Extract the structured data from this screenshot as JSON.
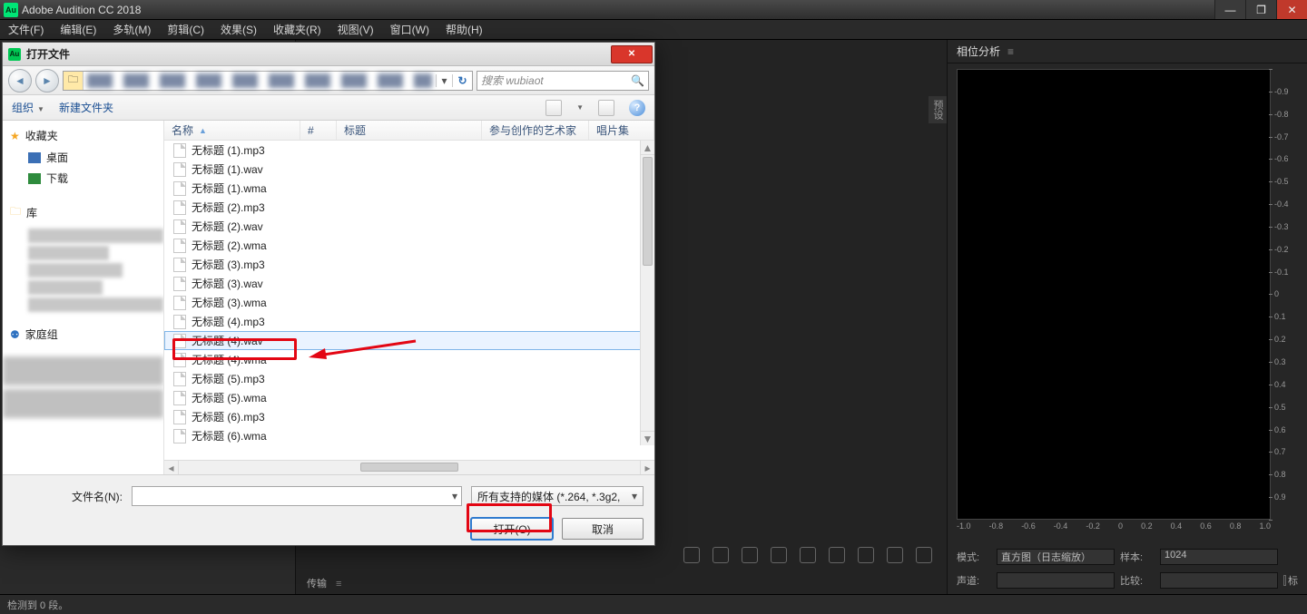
{
  "app": {
    "name": "Adobe Audition CC 2018",
    "icon_text": "Au"
  },
  "menus": [
    {
      "label": "文件(F)"
    },
    {
      "label": "编辑(E)"
    },
    {
      "label": "多轨(M)"
    },
    {
      "label": "剪辑(C)"
    },
    {
      "label": "效果(S)"
    },
    {
      "label": "收藏夹(R)"
    },
    {
      "label": "视图(V)"
    },
    {
      "label": "窗口(W)"
    },
    {
      "label": "帮助(H)"
    }
  ],
  "right_panel": {
    "title": "相位分析",
    "y_ticks": [
      "",
      "-0.9",
      "-0.8",
      "-0.7",
      "-0.6",
      "-0.5",
      "-0.4",
      "-0.3",
      "-0.2",
      "-0.1",
      "0",
      "0.1",
      "0.2",
      "0.3",
      "0.4",
      "0.5",
      "0.6",
      "0.7",
      "0.8",
      "0.9",
      ""
    ],
    "x_ticks": [
      "-1.0",
      "-0.8",
      "-0.6",
      "-0.4",
      "-0.2",
      "0",
      "0.2",
      "0.4",
      "0.6",
      "0.8",
      "1.0"
    ],
    "controls": {
      "mode_lbl": "模式:",
      "mode_val": "直方图（日志缩放）",
      "sample_lbl": "样本:",
      "sample_val": "1024",
      "ch_lbl": "声道:",
      "ch_val": "",
      "cmp_lbl": "比较:",
      "cmp_val": "",
      "mark_lbl": "标"
    }
  },
  "sidebar_tab": "预设",
  "transport": "传输",
  "status_left": "检测到 0 段。",
  "dialog": {
    "title": "打开文件",
    "search_placeholder": "搜索 wubiaot",
    "organize": "组织",
    "new_folder": "新建文件夹",
    "columns": {
      "name": "名称",
      "num": "#",
      "title": "标题",
      "artist": "参与创作的艺术家",
      "album": "唱片集"
    },
    "files": [
      "无标题 (1).mp3",
      "无标题 (1).wav",
      "无标题 (1).wma",
      "无标题 (2).mp3",
      "无标题 (2).wav",
      "无标题 (2).wma",
      "无标题 (3).mp3",
      "无标题 (3).wav",
      "无标题 (3).wma",
      "无标题 (4).mp3",
      "无标题 (4).wav",
      "无标题 (4).wma",
      "无标题 (5).mp3",
      "无标题 (5).wma",
      "无标题 (6).mp3",
      "无标题 (6).wma"
    ],
    "selected_index": 10,
    "nav": {
      "favorites": "收藏夹",
      "desktop": "桌面",
      "downloads": "下载",
      "libraries": "库",
      "homegroup": "家庭组"
    },
    "footer": {
      "filename_lbl": "文件名(N):",
      "filter": "所有支持的媒体 (*.264, *.3g2,",
      "open": "打开(O)",
      "cancel": "取消"
    }
  }
}
